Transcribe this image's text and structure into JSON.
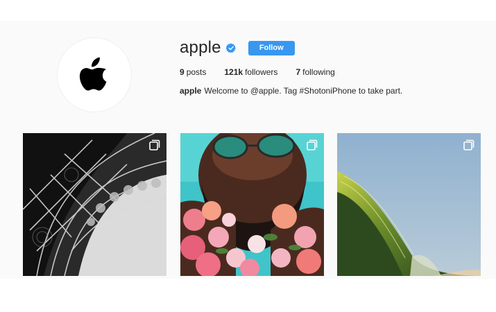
{
  "profile": {
    "username": "apple",
    "follow_label": "Follow",
    "stats": [
      {
        "value": "9",
        "label": "posts"
      },
      {
        "value": "121k",
        "label": "followers"
      },
      {
        "value": "7",
        "label": "following"
      }
    ],
    "bio_name": "apple",
    "bio_text": "Welcome to @apple. Tag #ShotoniPhone to take part."
  },
  "icons": {
    "avatar": "apple-logo",
    "verified": "verified-badge-icon",
    "post_overlay": "multiple-photos-icon"
  },
  "colors": {
    "follow_button": "#3897f0",
    "verified_badge": "#3897f0",
    "page_background": "#fafafa"
  }
}
